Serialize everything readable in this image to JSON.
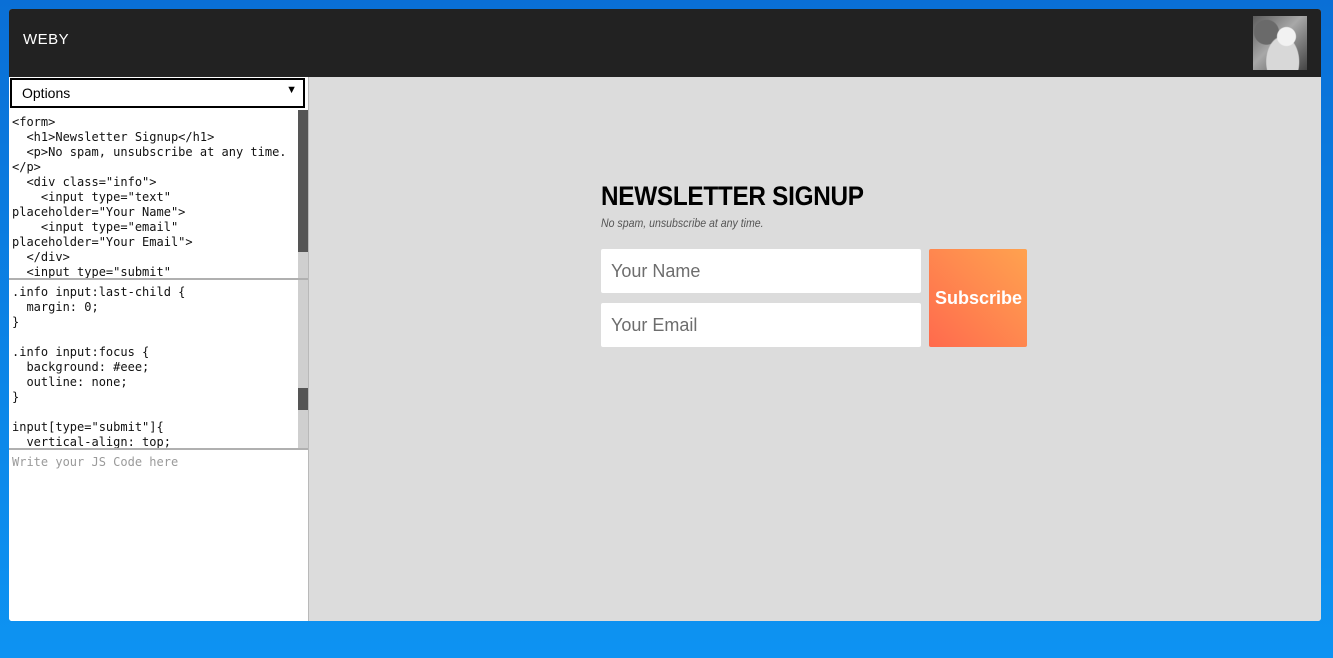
{
  "header": {
    "brand": "WEBY",
    "avatar_icon": "user-avatar-photo"
  },
  "options_select": {
    "selected": "Options",
    "arrow_icon": "triangle-down-icon"
  },
  "html_editor": {
    "code": "<form>\n  <h1>Newsletter Signup</h1>\n  <p>No spam, unsubscribe at any time.\n</p>\n  <div class=\"info\">\n    <input type=\"text\"\nplaceholder=\"Your Name\">\n    <input type=\"email\"\nplaceholder=\"Your Email\">\n  </div>\n  <input type=\"submit\""
  },
  "css_editor": {
    "code": ".info input:last-child {\n  margin: 0;\n}\n\n.info input:focus {\n  background: #eee;\n  outline: none;\n}\n\ninput[type=\"submit\"]{\n  vertical-align: top;"
  },
  "js_editor": {
    "placeholder": "Write your JS Code here"
  },
  "preview": {
    "title": "NEWSLETTER SIGNUP",
    "subtitle": "No spam, unsubscribe at any time.",
    "name_placeholder": "Your Name",
    "email_placeholder": "Your Email",
    "submit_label": "Subscribe",
    "accent_color": "#ff7a4f"
  }
}
